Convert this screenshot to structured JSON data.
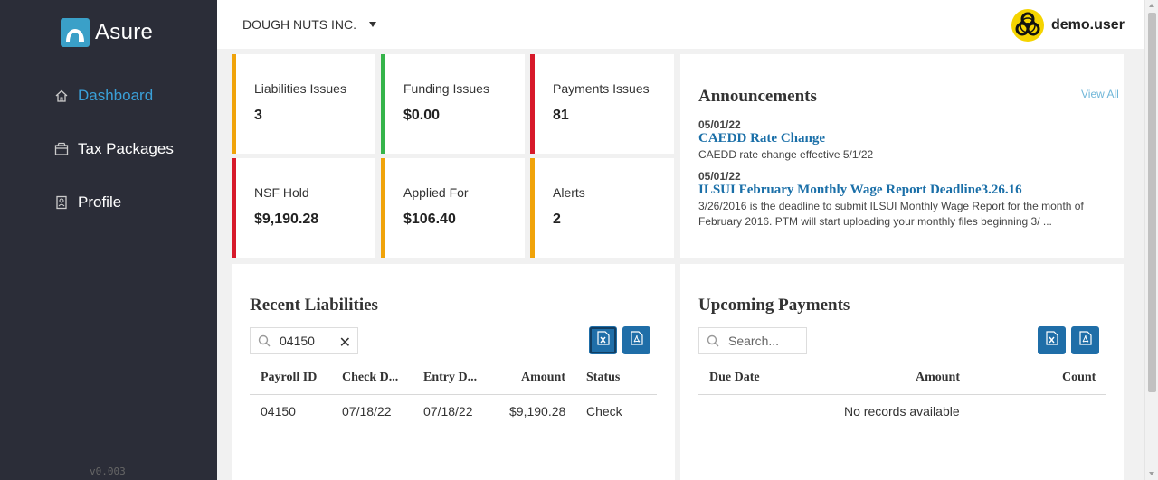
{
  "app": {
    "name": "Asure",
    "version": "v0.003"
  },
  "sidebar": {
    "items": [
      {
        "label": "Dashboard",
        "icon": "home-icon"
      },
      {
        "label": "Tax Packages",
        "icon": "package-icon"
      },
      {
        "label": "Profile",
        "icon": "profile-icon"
      }
    ]
  },
  "header": {
    "company": "DOUGH NUTS INC.",
    "username": "demo.user"
  },
  "stats": [
    {
      "label": "Liabilities Issues",
      "value": "3",
      "color": "#f0a30a"
    },
    {
      "label": "Funding Issues",
      "value": "$0.00",
      "color": "#35b44a"
    },
    {
      "label": "Payments Issues",
      "value": "81",
      "color": "#d7192a"
    },
    {
      "label": "NSF Hold",
      "value": "$9,190.28",
      "color": "#d7192a"
    },
    {
      "label": "Applied For",
      "value": "$106.40",
      "color": "#f0a30a"
    },
    {
      "label": "Alerts",
      "value": "2",
      "color": "#f0a30a"
    }
  ],
  "announcements": {
    "title": "Announcements",
    "view_all": "View All",
    "items": [
      {
        "date": "05/01/22",
        "title": "CAEDD Rate Change",
        "body": "CAEDD rate change effective 5/1/22"
      },
      {
        "date": "05/01/22",
        "title": "ILSUI February Monthly Wage Report Deadline3.26.16",
        "body": "3/26/2016 is the deadline to submit ILSUI Monthly Wage Report for the month of February 2016. PTM will start uploading your monthly files beginning 3/ ..."
      }
    ]
  },
  "recent_liabilities": {
    "title": "Recent Liabilities",
    "search_value": "04150",
    "columns": [
      "Payroll ID",
      "Check D...",
      "Entry D...",
      "Amount",
      "Status"
    ],
    "rows": [
      [
        "04150",
        "07/18/22",
        "07/18/22",
        "$9,190.28",
        "Check"
      ]
    ]
  },
  "upcoming_payments": {
    "title": "Upcoming Payments",
    "search_placeholder": "Search...",
    "columns": [
      "Due Date",
      "Amount",
      "Count"
    ],
    "empty_text": "No records available"
  },
  "colors": {
    "sidebar_bg": "#2b2d38",
    "accent": "#3aa0d8",
    "button": "#1f6ea8",
    "link": "#1a6fa8"
  }
}
